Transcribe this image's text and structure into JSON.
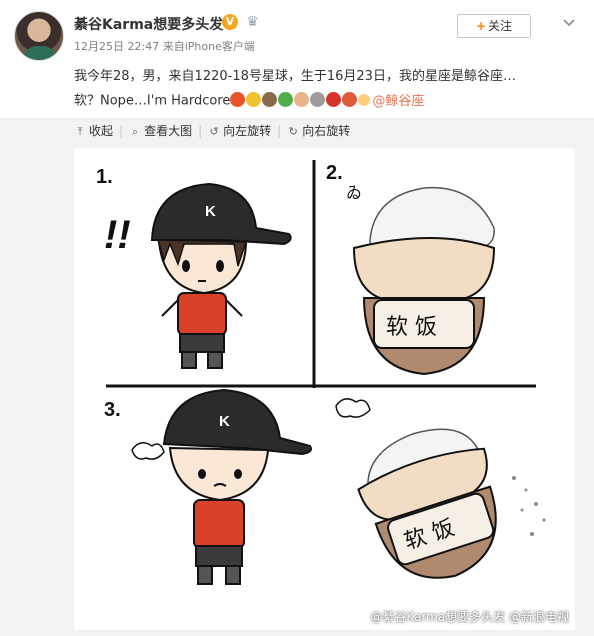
{
  "post": {
    "username": "綦谷Karma想要多头发",
    "verified_badge": "V",
    "meta": {
      "date": "12月25日 22:47",
      "source_prefix": "来自",
      "source": "iPhone客户端"
    },
    "follow_label": "关注",
    "text_line1": "我今年28，男，来自1220-18号星球，生于16月23日，我的星座是鲸谷座…",
    "text_line2_prefix": "软？Nope…I'm Hardcore",
    "mention": "@鲸谷座"
  },
  "toolbar": {
    "collapse": "收起",
    "view_large": "查看大图",
    "rotate_left": "向左旋转",
    "rotate_right": "向右旋转"
  },
  "comic": {
    "panel_numbers": [
      "1.",
      "2.",
      "3."
    ],
    "exclaim": "!!",
    "cap_letter": "K",
    "rice_label": "软 饭",
    "squiggle": "ゐ"
  },
  "watermark": "@綦谷Karma想要多头发 @新浪电视",
  "colors": {
    "accent_orange": "#ff8200",
    "mention_color": "#eb7350",
    "shirt_red": "#d9412a",
    "bowl_brown": "#b08a6e"
  },
  "icons": {
    "collapse": "arrow-up-icon",
    "view_large": "magnify-icon",
    "rotate_left": "rotate-left-icon",
    "rotate_right": "rotate-right-icon"
  }
}
